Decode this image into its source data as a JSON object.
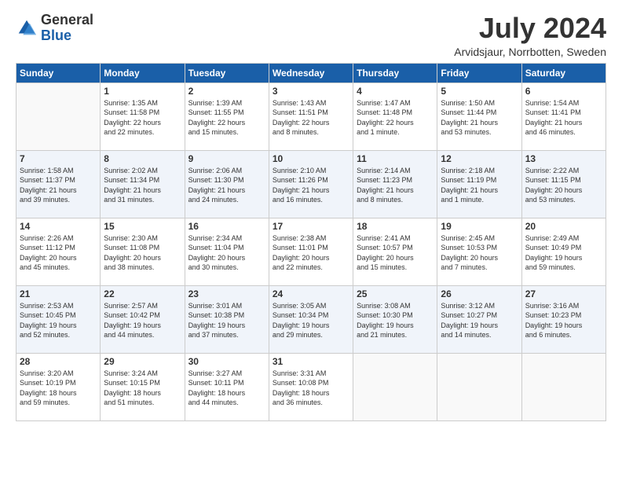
{
  "logo": {
    "general": "General",
    "blue": "Blue"
  },
  "header": {
    "month": "July 2024",
    "location": "Arvidsjaur, Norrbotten, Sweden"
  },
  "days_of_week": [
    "Sunday",
    "Monday",
    "Tuesday",
    "Wednesday",
    "Thursday",
    "Friday",
    "Saturday"
  ],
  "weeks": [
    [
      {
        "num": "",
        "info": ""
      },
      {
        "num": "1",
        "info": "Sunrise: 1:35 AM\nSunset: 11:58 PM\nDaylight: 22 hours\nand 22 minutes."
      },
      {
        "num": "2",
        "info": "Sunrise: 1:39 AM\nSunset: 11:55 PM\nDaylight: 22 hours\nand 15 minutes."
      },
      {
        "num": "3",
        "info": "Sunrise: 1:43 AM\nSunset: 11:51 PM\nDaylight: 22 hours\nand 8 minutes."
      },
      {
        "num": "4",
        "info": "Sunrise: 1:47 AM\nSunset: 11:48 PM\nDaylight: 22 hours\nand 1 minute."
      },
      {
        "num": "5",
        "info": "Sunrise: 1:50 AM\nSunset: 11:44 PM\nDaylight: 21 hours\nand 53 minutes."
      },
      {
        "num": "6",
        "info": "Sunrise: 1:54 AM\nSunset: 11:41 PM\nDaylight: 21 hours\nand 46 minutes."
      }
    ],
    [
      {
        "num": "7",
        "info": "Sunrise: 1:58 AM\nSunset: 11:37 PM\nDaylight: 21 hours\nand 39 minutes."
      },
      {
        "num": "8",
        "info": "Sunrise: 2:02 AM\nSunset: 11:34 PM\nDaylight: 21 hours\nand 31 minutes."
      },
      {
        "num": "9",
        "info": "Sunrise: 2:06 AM\nSunset: 11:30 PM\nDaylight: 21 hours\nand 24 minutes."
      },
      {
        "num": "10",
        "info": "Sunrise: 2:10 AM\nSunset: 11:26 PM\nDaylight: 21 hours\nand 16 minutes."
      },
      {
        "num": "11",
        "info": "Sunrise: 2:14 AM\nSunset: 11:23 PM\nDaylight: 21 hours\nand 8 minutes."
      },
      {
        "num": "12",
        "info": "Sunrise: 2:18 AM\nSunset: 11:19 PM\nDaylight: 21 hours\nand 1 minute."
      },
      {
        "num": "13",
        "info": "Sunrise: 2:22 AM\nSunset: 11:15 PM\nDaylight: 20 hours\nand 53 minutes."
      }
    ],
    [
      {
        "num": "14",
        "info": "Sunrise: 2:26 AM\nSunset: 11:12 PM\nDaylight: 20 hours\nand 45 minutes."
      },
      {
        "num": "15",
        "info": "Sunrise: 2:30 AM\nSunset: 11:08 PM\nDaylight: 20 hours\nand 38 minutes."
      },
      {
        "num": "16",
        "info": "Sunrise: 2:34 AM\nSunset: 11:04 PM\nDaylight: 20 hours\nand 30 minutes."
      },
      {
        "num": "17",
        "info": "Sunrise: 2:38 AM\nSunset: 11:01 PM\nDaylight: 20 hours\nand 22 minutes."
      },
      {
        "num": "18",
        "info": "Sunrise: 2:41 AM\nSunset: 10:57 PM\nDaylight: 20 hours\nand 15 minutes."
      },
      {
        "num": "19",
        "info": "Sunrise: 2:45 AM\nSunset: 10:53 PM\nDaylight: 20 hours\nand 7 minutes."
      },
      {
        "num": "20",
        "info": "Sunrise: 2:49 AM\nSunset: 10:49 PM\nDaylight: 19 hours\nand 59 minutes."
      }
    ],
    [
      {
        "num": "21",
        "info": "Sunrise: 2:53 AM\nSunset: 10:45 PM\nDaylight: 19 hours\nand 52 minutes."
      },
      {
        "num": "22",
        "info": "Sunrise: 2:57 AM\nSunset: 10:42 PM\nDaylight: 19 hours\nand 44 minutes."
      },
      {
        "num": "23",
        "info": "Sunrise: 3:01 AM\nSunset: 10:38 PM\nDaylight: 19 hours\nand 37 minutes."
      },
      {
        "num": "24",
        "info": "Sunrise: 3:05 AM\nSunset: 10:34 PM\nDaylight: 19 hours\nand 29 minutes."
      },
      {
        "num": "25",
        "info": "Sunrise: 3:08 AM\nSunset: 10:30 PM\nDaylight: 19 hours\nand 21 minutes."
      },
      {
        "num": "26",
        "info": "Sunrise: 3:12 AM\nSunset: 10:27 PM\nDaylight: 19 hours\nand 14 minutes."
      },
      {
        "num": "27",
        "info": "Sunrise: 3:16 AM\nSunset: 10:23 PM\nDaylight: 19 hours\nand 6 minutes."
      }
    ],
    [
      {
        "num": "28",
        "info": "Sunrise: 3:20 AM\nSunset: 10:19 PM\nDaylight: 18 hours\nand 59 minutes."
      },
      {
        "num": "29",
        "info": "Sunrise: 3:24 AM\nSunset: 10:15 PM\nDaylight: 18 hours\nand 51 minutes."
      },
      {
        "num": "30",
        "info": "Sunrise: 3:27 AM\nSunset: 10:11 PM\nDaylight: 18 hours\nand 44 minutes."
      },
      {
        "num": "31",
        "info": "Sunrise: 3:31 AM\nSunset: 10:08 PM\nDaylight: 18 hours\nand 36 minutes."
      },
      {
        "num": "",
        "info": ""
      },
      {
        "num": "",
        "info": ""
      },
      {
        "num": "",
        "info": ""
      }
    ]
  ]
}
